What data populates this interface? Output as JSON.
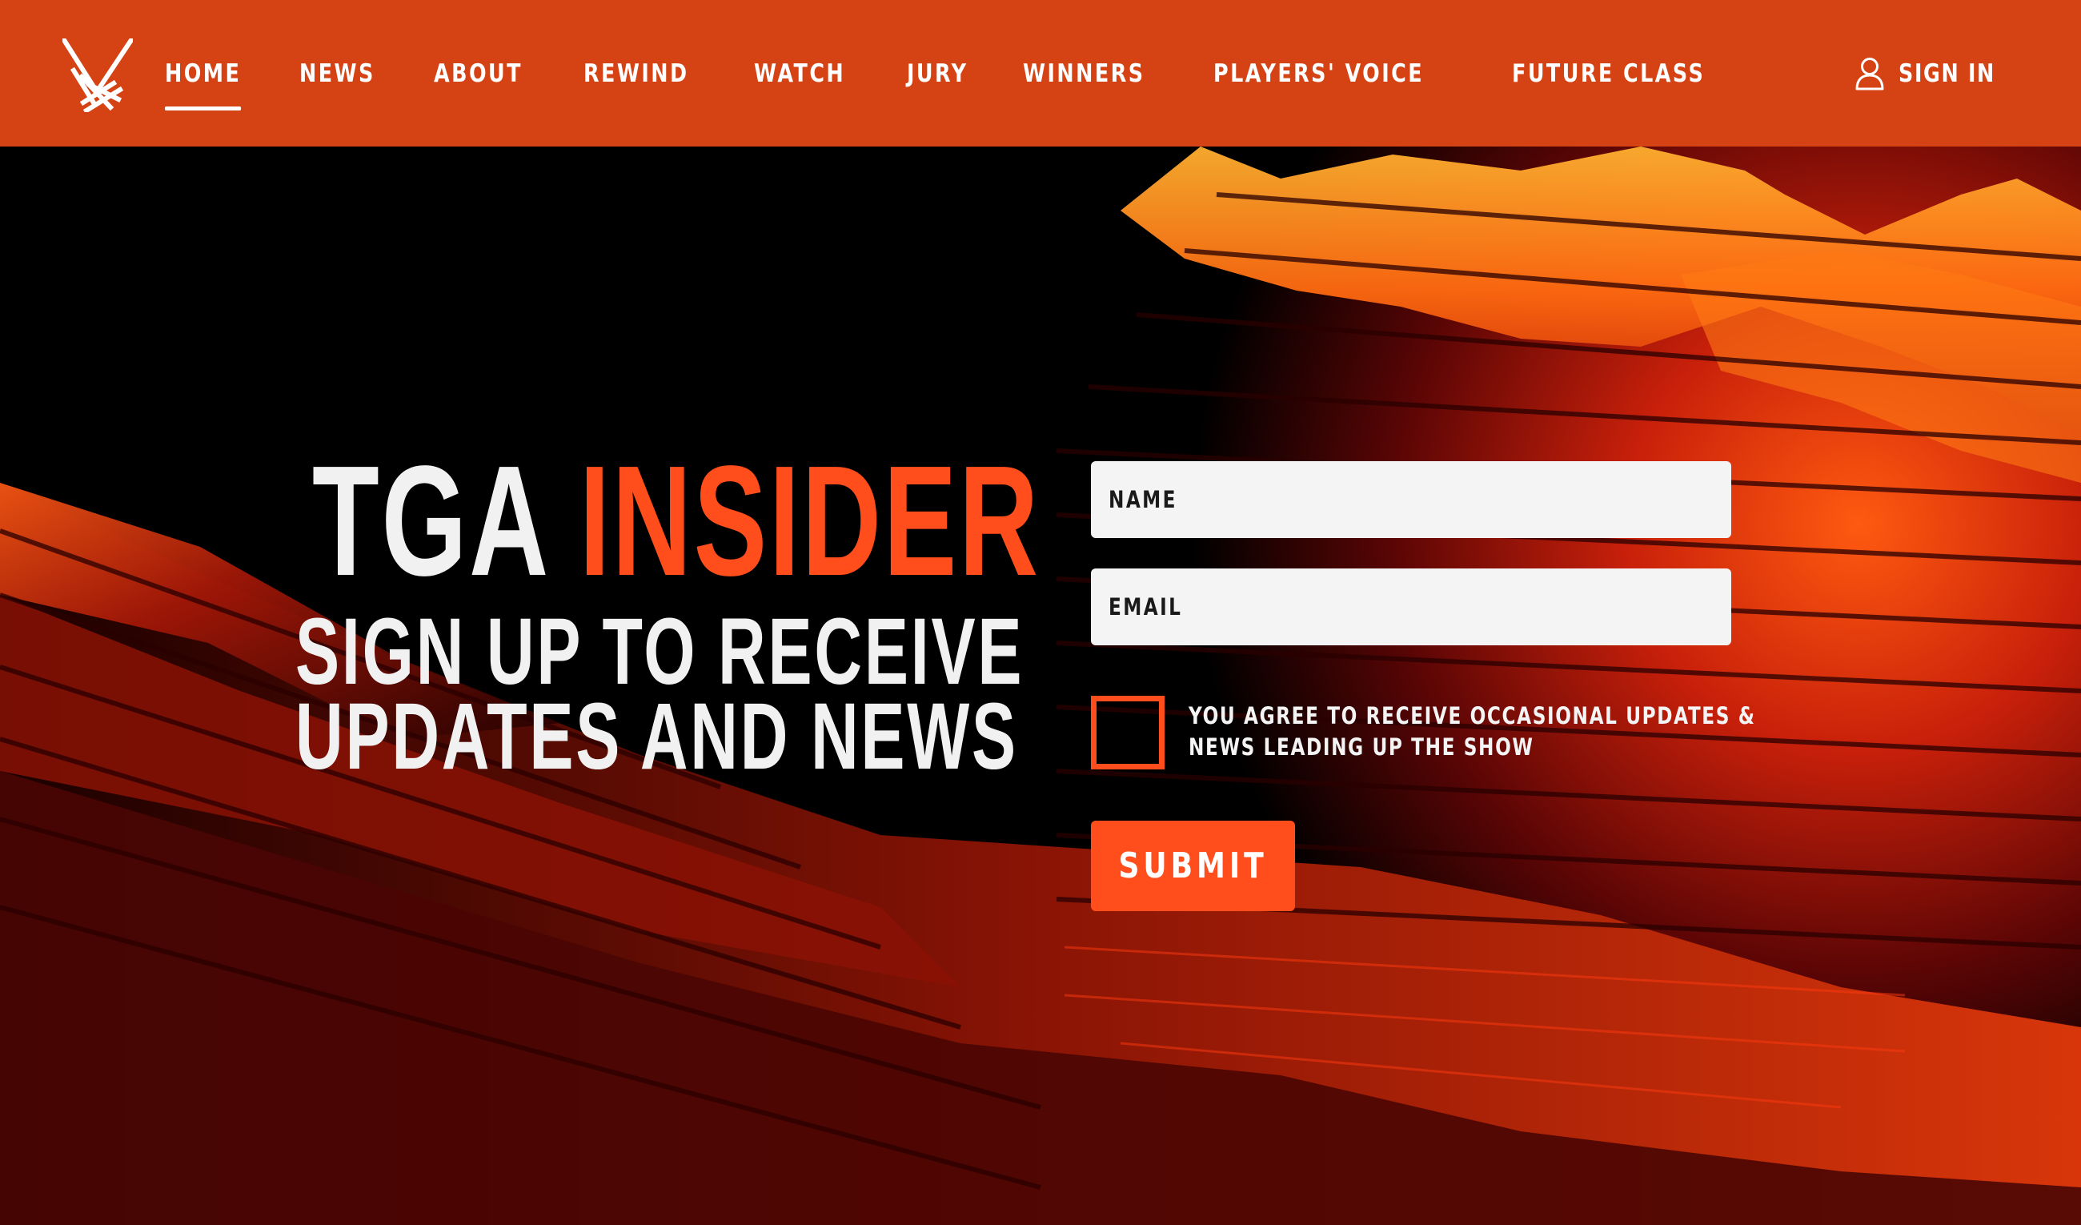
{
  "nav": {
    "logo_icon": "tga-logo-icon",
    "items": [
      {
        "label": "HOME",
        "active": true
      },
      {
        "label": "NEWS",
        "active": false
      },
      {
        "label": "ABOUT",
        "active": false
      },
      {
        "label": "REWIND",
        "active": false
      },
      {
        "label": "WATCH",
        "active": false
      },
      {
        "label": "JURY",
        "active": false
      },
      {
        "label": "WINNERS",
        "active": false
      },
      {
        "label": "PLAYERS' VOICE",
        "active": false
      },
      {
        "label": "FUTURE CLASS",
        "active": false
      }
    ],
    "sign_in": {
      "label": "SIGN IN",
      "icon": "user-icon"
    }
  },
  "hero": {
    "title_part1": "TGA",
    "title_part2": "INSIDER",
    "subtitle_line1": "SIGN UP TO RECEIVE",
    "subtitle_line2": "UPDATES AND NEWS"
  },
  "form": {
    "name_placeholder": "NAME",
    "email_placeholder": "EMAIL",
    "consent_line1": "YOU AGREE TO RECEIVE OCCASIONAL UPDATES &",
    "consent_line2": "NEWS LEADING UP THE SHOW",
    "consent_checked": false,
    "submit_label": "SUBMIT"
  },
  "colors": {
    "nav_bg": "#d54213",
    "accent": "#ff4d1c",
    "text_light": "#f1f1f1",
    "field_bg": "#f4f4f4"
  }
}
